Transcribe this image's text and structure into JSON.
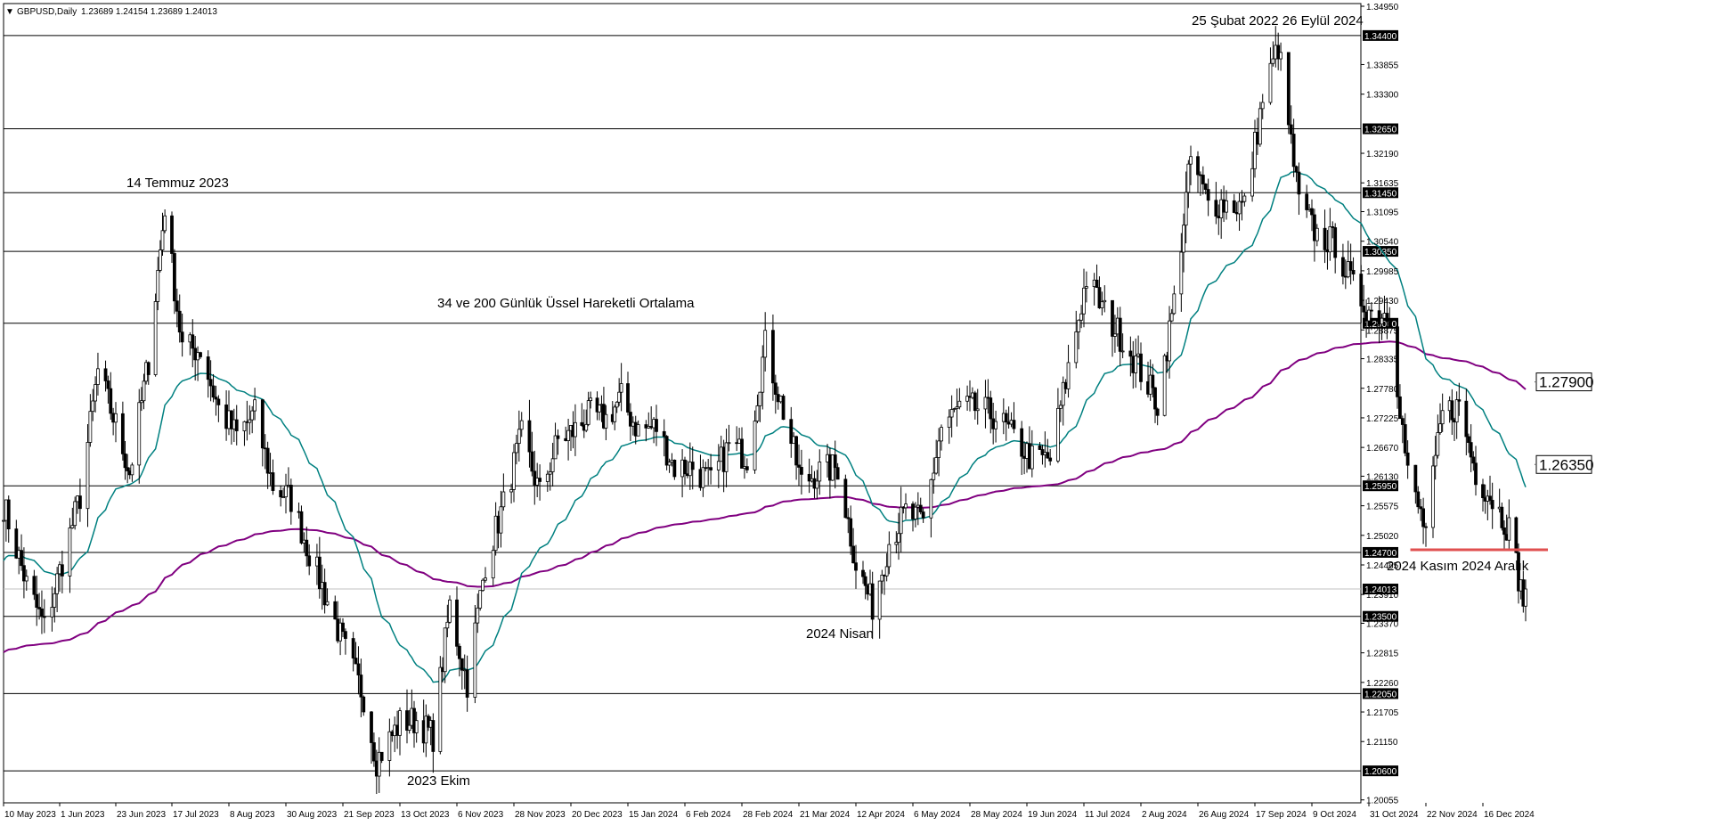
{
  "header": {
    "symbol": "GBPUSD,Daily",
    "ohlc": "1.23689 1.24154 1.23689 1.24013"
  },
  "chart_data": {
    "type": "candlestick",
    "title": "34 ve 200 Günlük Üssel Hareketli Ortalama",
    "symbol": "GBPUSD",
    "timeframe": "Daily",
    "ylim": [
      1.2,
      1.35
    ],
    "grid": false,
    "current_price": 1.24013,
    "x_ticks": [
      "10 May 2023",
      "1 Jun 2023",
      "23 Jun 2023",
      "17 Jul 2023",
      "8 Aug 2023",
      "30 Aug 2023",
      "21 Sep 2023",
      "13 Oct 2023",
      "6 Nov 2023",
      "28 Nov 2023",
      "20 Dec 2023",
      "15 Jan 2024",
      "6 Feb 2024",
      "28 Feb 2024",
      "21 Mar 2024",
      "12 Apr 2024",
      "6 May 2024",
      "28 May 2024",
      "19 Jun 2024",
      "11 Jul 2024",
      "2 Aug 2024",
      "26 Aug 2024",
      "17 Sep 2024",
      "9 Oct 2024",
      "31 Oct 2024",
      "22 Nov 2024",
      "16 Dec 2024"
    ],
    "y_ticks": [
      "1.34950",
      "1.33855",
      "1.33300",
      "1.32190",
      "1.31635",
      "1.31095",
      "1.30540",
      "1.29985",
      "1.29430",
      "1.28875",
      "1.28335",
      "1.27780",
      "1.27225",
      "1.26670",
      "1.26130",
      "1.25575",
      "1.25020",
      "1.24465",
      "1.23910",
      "1.23370",
      "1.22815",
      "1.22260",
      "1.21705",
      "1.21150",
      "1.20055"
    ],
    "levels": [
      "1.34400",
      "1.32650",
      "1.31450",
      "1.30350",
      "1.29000",
      "1.25950",
      "1.24700",
      "1.24013",
      "1.23500",
      "1.22050",
      "1.20600"
    ],
    "ema_labels": [
      "1.27900",
      "1.26350"
    ],
    "annotations": [
      "25 Şubat 2022  26 Eylül 2024",
      "14 Temmuz 2023",
      "34 ve 200 Günlük Üssel Hareketli Ortalama",
      "2024 Nisan",
      "2023 Ekim",
      "2024 Kasım  2024 Aralık"
    ],
    "closes_anchor": [
      [
        "10 May 2023",
        1.256
      ],
      [
        "19 May 2023",
        1.241
      ],
      [
        "26 May 2023",
        1.233
      ],
      [
        "1 Jun 2023",
        1.2435
      ],
      [
        "9 Jun 2023",
        1.2575
      ],
      [
        "16 Jun 2023",
        1.281
      ],
      [
        "23 Jun 2023",
        1.271
      ],
      [
        "29 Jun 2023",
        1.262
      ],
      [
        "7 Jul 2023",
        1.283
      ],
      [
        "14 Jul 2023",
        1.312
      ],
      [
        "21 Jul 2023",
        1.2855
      ],
      [
        "28 Jul 2023",
        1.285
      ],
      [
        "4 Aug 2023",
        1.274
      ],
      [
        "11 Aug 2023",
        1.269
      ],
      [
        "18 Aug 2023",
        1.273
      ],
      [
        "25 Aug 2023",
        1.2595
      ],
      [
        "1 Sep 2023",
        1.257
      ],
      [
        "8 Sep 2023",
        1.247
      ],
      [
        "15 Sep 2023",
        1.238
      ],
      [
        "22 Sep 2023",
        1.2285
      ],
      [
        "29 Sep 2023",
        1.22
      ],
      [
        "4 Oct 2023",
        1.208
      ],
      [
        "13 Oct 2023",
        1.215
      ],
      [
        "20 Oct 2023",
        1.2155
      ],
      [
        "27 Oct 2023",
        1.2125
      ],
      [
        "3 Nov 2023",
        1.237
      ],
      [
        "10 Nov 2023",
        1.2225
      ],
      [
        "17 Nov 2023",
        1.245
      ],
      [
        "24 Nov 2023",
        1.256
      ],
      [
        "1 Dec 2023",
        1.269
      ],
      [
        "8 Dec 2023",
        1.258
      ],
      [
        "15 Dec 2023",
        1.268
      ],
      [
        "22 Dec 2023",
        1.27
      ],
      [
        "29 Dec 2023",
        1.273
      ],
      [
        "5 Jan 2024",
        1.272
      ],
      [
        "12 Jan 2024",
        1.276
      ],
      [
        "19 Jan 2024",
        1.27
      ],
      [
        "26 Jan 2024",
        1.2705
      ],
      [
        "2 Feb 2024",
        1.263
      ],
      [
        "9 Feb 2024",
        1.263
      ],
      [
        "16 Feb 2024",
        1.26
      ],
      [
        "23 Feb 2024",
        1.267
      ],
      [
        "1 Mar 2024",
        1.265
      ],
      [
        "8 Mar 2024",
        1.286
      ],
      [
        "15 Mar 2024",
        1.2735
      ],
      [
        "22 Mar 2024",
        1.26
      ],
      [
        "28 Mar 2024",
        1.262
      ],
      [
        "5 Apr 2024",
        1.263
      ],
      [
        "12 Apr 2024",
        1.245
      ],
      [
        "19 Apr 2024",
        1.237
      ],
      [
        "26 Apr 2024",
        1.249
      ],
      [
        "3 May 2024",
        1.2545
      ],
      [
        "10 May 2024",
        1.2525
      ],
      [
        "17 May 2024",
        1.2705
      ],
      [
        "24 May 2024",
        1.274
      ],
      [
        "31 May 2024",
        1.274
      ],
      [
        "7 Jun 2024",
        1.2725
      ],
      [
        "14 Jun 2024",
        1.2685
      ],
      [
        "21 Jun 2024",
        1.2645
      ],
      [
        "28 Jun 2024",
        1.2645
      ],
      [
        "5 Jul 2024",
        1.2815
      ],
      [
        "12 Jul 2024",
        1.2985
      ],
      [
        "19 Jul 2024",
        1.292
      ],
      [
        "26 Jul 2024",
        1.287
      ],
      [
        "2 Aug 2024",
        1.281
      ],
      [
        "9 Aug 2024",
        1.275
      ],
      [
        "16 Aug 2024",
        1.294
      ],
      [
        "23 Aug 2024",
        1.321
      ],
      [
        "30 Aug 2024",
        1.3125
      ],
      [
        "6 Sep 2024",
        1.3125
      ],
      [
        "13 Sep 2024",
        1.312
      ],
      [
        "20 Sep 2024",
        1.332
      ],
      [
        "26 Sep 2024",
        1.342
      ],
      [
        "4 Oct 2024",
        1.3125
      ],
      [
        "11 Oct 2024",
        1.3065
      ],
      [
        "18 Oct 2024",
        1.305
      ],
      [
        "25 Oct 2024",
        1.2965
      ],
      [
        "1 Nov 2024",
        1.292
      ],
      [
        "8 Nov 2024",
        1.292
      ],
      [
        "15 Nov 2024",
        1.2615
      ],
      [
        "22 Nov 2024",
        1.251
      ],
      [
        "29 Nov 2024",
        1.273
      ],
      [
        "6 Dec 2024",
        1.2745
      ],
      [
        "13 Dec 2024",
        1.262
      ],
      [
        "20 Dec 2024",
        1.257
      ],
      [
        "27 Dec 2024",
        1.2515
      ],
      [
        "2 Jan 2025",
        1.238
      ],
      [
        "3 Jan 2025",
        1.24013
      ]
    ]
  },
  "colors": {
    "background": "#ffffff",
    "candle": "#000000",
    "ema34": "#008080",
    "ema200": "#800080",
    "marker_line": "#e05050",
    "level_label_bg": "#000000"
  }
}
